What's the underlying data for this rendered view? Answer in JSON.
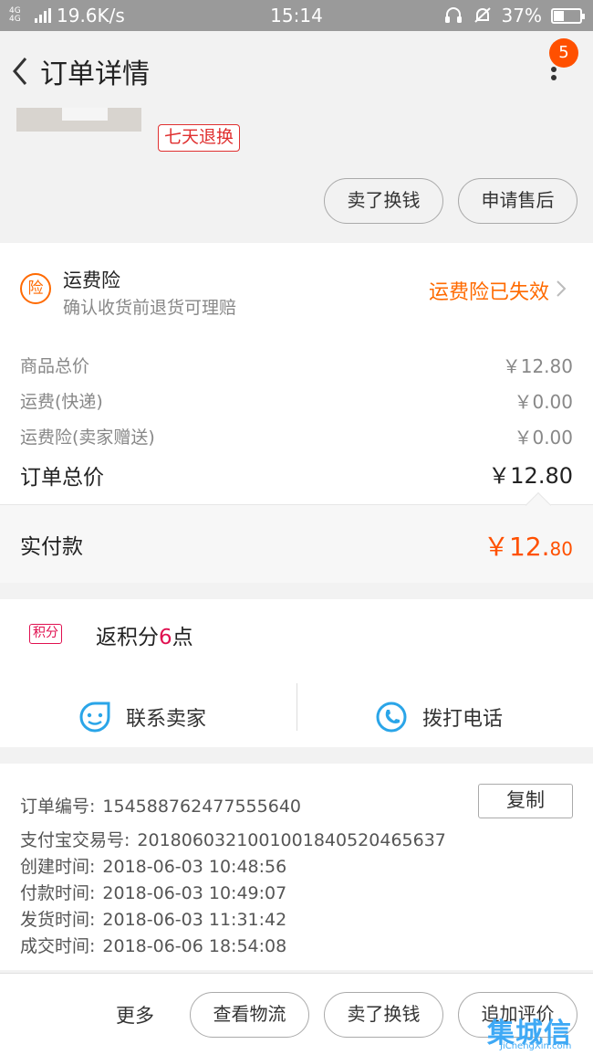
{
  "status_bar": {
    "network": "4G 4G",
    "speed": "19.6K/s",
    "time": "15:14",
    "battery": "37%",
    "battery_level": 0.37
  },
  "header": {
    "title": "订单详情",
    "notification_count": "5"
  },
  "product": {
    "tag": "七天退换",
    "buttons": [
      "卖了换钱",
      "申请售后"
    ]
  },
  "insurance": {
    "icon_char": "险",
    "title": "运费险",
    "subtitle": "确认收货前退货可理赔",
    "status": "运费险已失效"
  },
  "price_rows": [
    {
      "label": "商品总价",
      "value": "￥12.80"
    },
    {
      "label": "运费(快递)",
      "value": "￥0.00"
    },
    {
      "label": "运费险(卖家赠送)",
      "value": "￥0.00"
    }
  ],
  "order_total": {
    "label": "订单总价",
    "value": "￥12.80"
  },
  "paid": {
    "label": "实付款",
    "value_main": "￥12.",
    "value_cents": "80"
  },
  "points": {
    "tag": "积分",
    "text_before": "返积分",
    "number": "6",
    "text_after": "点"
  },
  "contact": {
    "seller": "联系卖家",
    "phone": "拨打电话"
  },
  "order_info": {
    "copy_label": "复制",
    "lines": [
      {
        "label": "订单编号:",
        "value": "154588762477555640"
      },
      {
        "label": "支付宝交易号:",
        "value": "2018060321001001840520465637"
      },
      {
        "label": "创建时间:",
        "value": "2018-06-03 10:48:56"
      },
      {
        "label": "付款时间:",
        "value": "2018-06-03 10:49:07"
      },
      {
        "label": "发货时间:",
        "value": "2018-06-03 11:31:42"
      },
      {
        "label": "成交时间:",
        "value": "2018-06-06 18:54:08"
      }
    ]
  },
  "bottom_bar": {
    "more": "更多",
    "buttons": [
      "查看物流",
      "卖了换钱",
      "追加评价"
    ]
  },
  "watermark": {
    "logo": "集城信",
    "url": "JiChengXin.com"
  },
  "colors": {
    "accent": "#ff5000",
    "insurance": "#ff6a00",
    "points": "#e01050",
    "contact_icon": "#2aa5e8"
  }
}
